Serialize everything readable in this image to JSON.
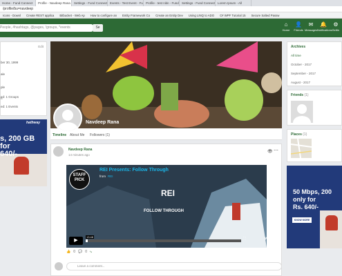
{
  "browser": {
    "tabs": [
      {
        "label": "Home - Fund Connect"
      },
      {
        "label": "Profile - Navdeep Rana"
      },
      {
        "label": "Settings - Fund Connect"
      },
      {
        "label": "Events - Test Event - Fund"
      },
      {
        "label": "Profile - test nitin - Fund"
      },
      {
        "label": "Settings - Fund Connect"
      },
      {
        "label": "Lorem Ipsum - All"
      }
    ],
    "url": "/profile/bu=navdeep",
    "bookmarks": [
      {
        "label": "Icons - Downl"
      },
      {
        "label": "Create REST applica"
      },
      {
        "label": "Bitbucket - Web Ap"
      },
      {
        "label": "How to configure an"
      },
      {
        "label": "Entity Framework Co"
      },
      {
        "label": "Create an Entity Dev"
      },
      {
        "label": "Using LINQ to ADO"
      },
      {
        "label": "C# WPF Tutorial 15"
      },
      {
        "label": "Secure Salted Passw"
      }
    ]
  },
  "header": {
    "search_placeholder": "People, #hashtags, @pages, !groups, *events",
    "search_button": "Se",
    "nav": [
      {
        "label": "Home",
        "glyph": "⌂"
      },
      {
        "label": "Friends",
        "glyph": "👤"
      },
      {
        "label": "Messages",
        "glyph": "✉"
      },
      {
        "label": "Notifications",
        "glyph": "🔔"
      },
      {
        "label": "Settin",
        "glyph": "⚙"
      }
    ]
  },
  "left": {
    "edit": "Edit",
    "lines": [
      "ber 30, 1999",
      "ale",
      "ple",
      "h",
      "ed: 1 Groups",
      "ed: 1 Events"
    ],
    "ad": {
      "brand": "hathway",
      "text1": "s, 200 GB",
      "text2": "for",
      "text3": "640/-"
    }
  },
  "profile": {
    "name": "Navdeep Rana",
    "tabs": [
      "Timeline",
      "About Me",
      "Followers (1)"
    ]
  },
  "post": {
    "author": "Navdeep Rana",
    "time": "14 minutes ago",
    "video": {
      "title": "REI Presents: Follow Through",
      "from_prefix": "from",
      "from": "REI",
      "badge": "STAFF PICK",
      "logo": "REI",
      "caption": "FOLLOW THROUGH",
      "time": "13:48",
      "progress": 0.01,
      "brand": "vimeo"
    },
    "likes": "0",
    "shares": "0",
    "comment_placeholder": "Leave a comment..."
  },
  "right": {
    "archives": {
      "title": "Archives",
      "items": [
        "All time",
        "October - 2017",
        "September - 2017",
        "August - 2017"
      ]
    },
    "friends": {
      "title": "Friends",
      "count": "(1)"
    },
    "places": {
      "title": "Places",
      "count": "(1)"
    },
    "ad": {
      "text1": "50 Mbps, 200",
      "text2": "only for",
      "text3": "Rs. 640/-",
      "cta": "KNOW MORE"
    }
  },
  "colors": {
    "header_green": "#2d6a35",
    "vimeo_blue": "#1ab7ea",
    "ad_blue": "#223a7a"
  }
}
